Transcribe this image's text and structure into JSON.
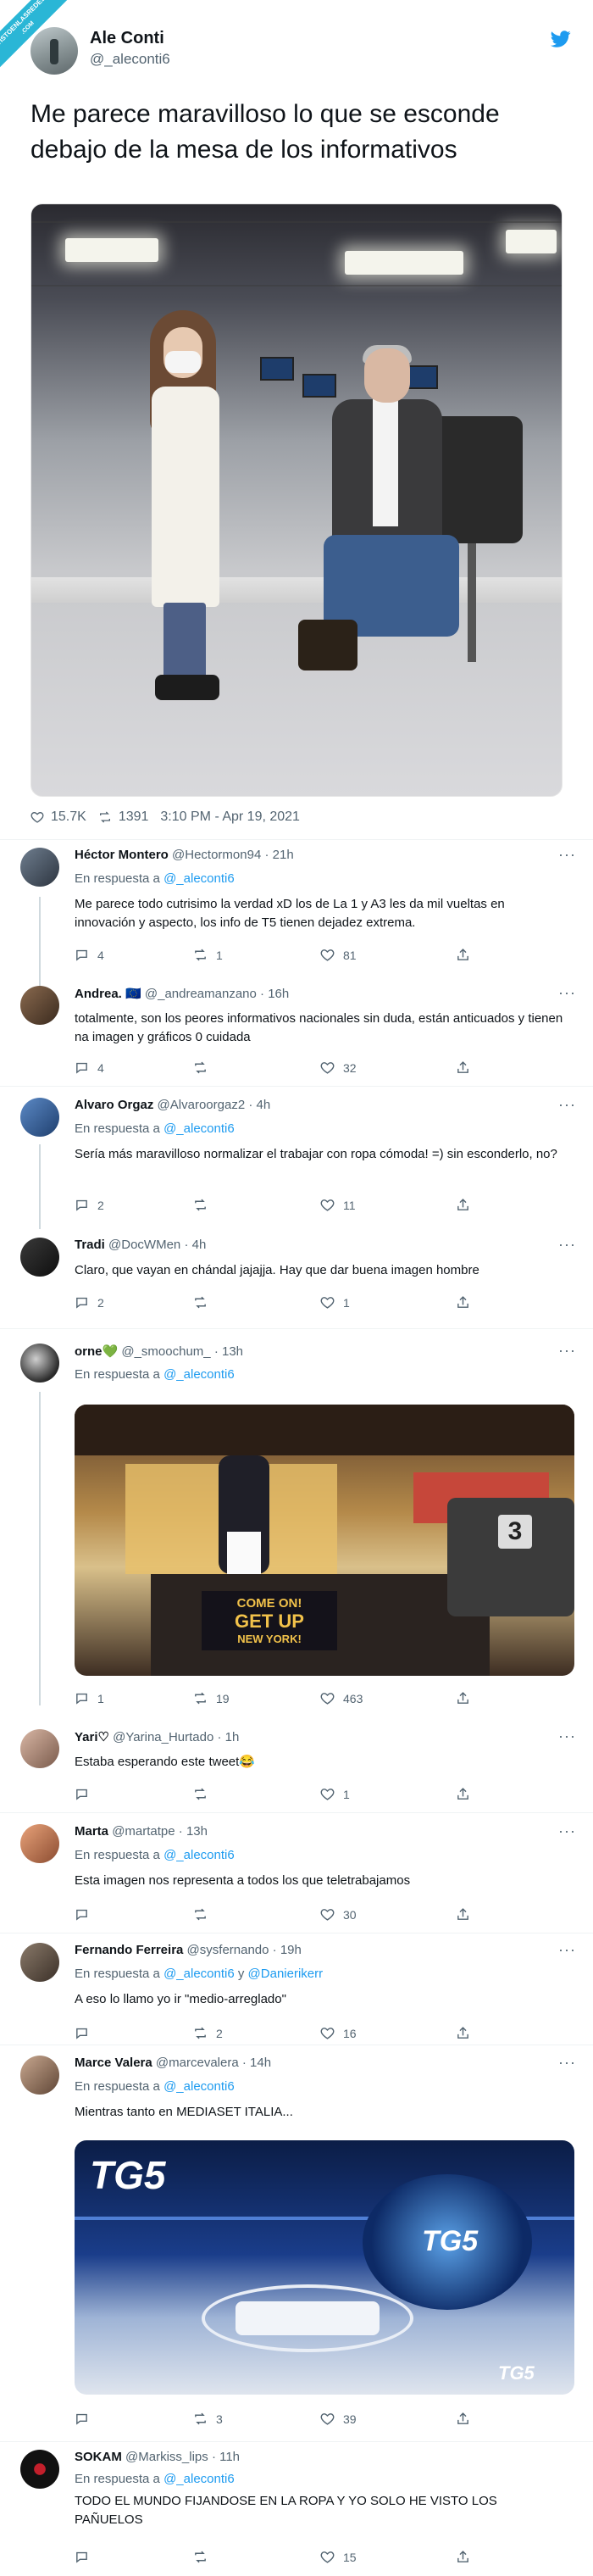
{
  "watermark": {
    "line1": "VISTOENLASREDES",
    "line2": ".COM"
  },
  "tweet": {
    "author_name": "Ale Conti",
    "author_handle": "@_aleconti6",
    "text": "Me parece maravilloso lo que se esconde debajo de la mesa de los informativos",
    "likes": "15.7K",
    "retweets": "1391",
    "timestamp": "3:10 PM - Apr 19, 2021"
  },
  "replies": [
    {
      "name": "Héctor Montero",
      "handle": "@Hectormon94",
      "time": "· 21h",
      "reply_to_label": "En respuesta a",
      "reply_to": "@_aleconti6",
      "text": "Me parece todo cutrisimo la verdad xD los de La 1 y A3 les da mil vueltas en innovación y aspecto, los info de T5 tienen dejadez extrema.",
      "replies_count": "4",
      "retweets_count": "1",
      "likes_count": "81"
    },
    {
      "name": "Andrea. 🇪🇺",
      "handle": "@_andreamanzano",
      "time": "· 16h",
      "text": "totalmente, son los peores informativos nacionales sin duda, están anticuados y tienen na imagen y gráficos 0 cuidada",
      "replies_count": "4",
      "retweets_count": "",
      "likes_count": "32"
    },
    {
      "name": "Alvaro Orgaz",
      "handle": "@Alvaroorgaz2",
      "time": "· 4h",
      "reply_to_label": "En respuesta a",
      "reply_to": "@_aleconti6",
      "text": "Sería más maravilloso normalizar el trabajar con ropa cómoda! =) sin esconderlo, no?",
      "replies_count": "2",
      "retweets_count": "",
      "likes_count": "11"
    },
    {
      "name": "Tradi",
      "handle": "@DocWMen",
      "time": "· 4h",
      "text": "Claro, que vayan en chándal jajajja. Hay que dar buena imagen hombre",
      "replies_count": "2",
      "retweets_count": "",
      "likes_count": "1"
    },
    {
      "name": "orne💚",
      "handle": "@_smoochum_",
      "time": "· 13h",
      "reply_to_label": "En respuesta a",
      "reply_to": "@_aleconti6",
      "text": "",
      "replies_count": "1",
      "retweets_count": "19",
      "likes_count": "463",
      "media_caption": {
        "line1": "COME ON!",
        "line2": "GET UP",
        "line3": "NEW YORK!"
      }
    },
    {
      "name": "Yari♡",
      "handle": "@Yarina_Hurtado",
      "time": "· 1h",
      "text": "Estaba esperando este tweet😂",
      "replies_count": "",
      "retweets_count": "",
      "likes_count": "1"
    },
    {
      "name": "Marta",
      "handle": "@martatpe",
      "time": "· 13h",
      "reply_to_label": "En respuesta a",
      "reply_to": "@_aleconti6",
      "text": "Esta imagen nos representa a todos los que teletrabajamos",
      "replies_count": "",
      "retweets_count": "",
      "likes_count": "30"
    },
    {
      "name": "Fernando Ferreira",
      "handle": "@sysfernando",
      "time": "· 19h",
      "reply_to_label": "En respuesta a",
      "reply_to": "@_aleconti6",
      "reply_to_and": "y",
      "reply_to_2": "@Danierikerr",
      "text": "A eso lo llamo yo ir \"medio-arreglado\"",
      "replies_count": "",
      "retweets_count": "2",
      "likes_count": "16"
    },
    {
      "name": "Marce Valera",
      "handle": "@marcevalera",
      "time": "· 14h",
      "reply_to_label": "En respuesta a",
      "reply_to": "@_aleconti6",
      "text": "Mientras tanto en MEDIASET ITALIA...",
      "replies_count": "",
      "retweets_count": "3",
      "likes_count": "39",
      "media_logo": "TG5"
    },
    {
      "name": "SOKAM",
      "handle": "@Markiss_lips",
      "time": "· 11h",
      "reply_to_label": "En respuesta a",
      "reply_to": "@_aleconti6",
      "text": "TODO EL MUNDO FIJANDOSE EN LA ROPA Y YO SOLO HE VISTO LOS PAÑUELOS",
      "replies_count": "",
      "retweets_count": "",
      "likes_count": "15"
    }
  ],
  "colors": {
    "accent": "#1d9bf0",
    "muted": "#536471",
    "text": "#0f1419"
  }
}
